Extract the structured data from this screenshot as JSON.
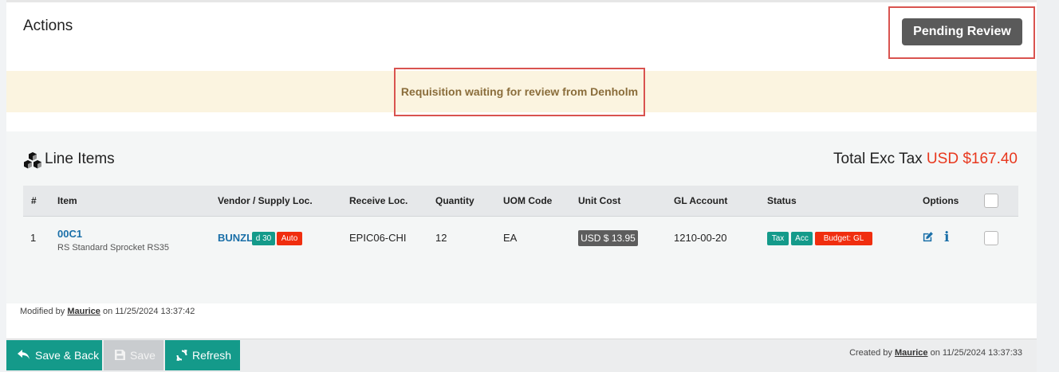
{
  "actions": {
    "title": "Actions",
    "pending_button": "Pending Review"
  },
  "notice": "Requisition waiting for review from Denholm",
  "line_items": {
    "title": "Line Items",
    "total_label": "Total Exc Tax",
    "total_amount": "USD $167.40",
    "columns": {
      "num": "#",
      "item": "Item",
      "vendor": "Vendor / Supply Loc.",
      "receive": "Receive Loc.",
      "quantity": "Quantity",
      "uom": "UOM Code",
      "unit_cost": "Unit Cost",
      "gl": "GL Account",
      "status": "Status",
      "options": "Options"
    },
    "rows": [
      {
        "num": "1",
        "item_code": "00C1",
        "item_desc": "RS Standard Sprocket RS35",
        "vendor": "BUNZL",
        "vendor_badges": [
          "d 30",
          "Auto"
        ],
        "receive": "EPIC06-CHI",
        "quantity": "12",
        "uom": "EA",
        "unit_cost": "USD $ 13.95",
        "gl": "1210-00-20",
        "status_badges": [
          "Tax",
          "Acc",
          "Budget: GL"
        ]
      }
    ]
  },
  "modified": {
    "prefix": "Modified by",
    "user": "Maurice",
    "suffix": "on 11/25/2024 13:37:42"
  },
  "footer": {
    "save_back": "Save & Back",
    "save": "Save",
    "refresh": "Refresh",
    "created_prefix": "Created by",
    "created_user": "Maurice",
    "created_suffix": "on 11/25/2024 13:37:33"
  },
  "colors": {
    "accent_teal": "#149a8a",
    "danger_red": "#f02e0f",
    "link_blue": "#1a6fa8",
    "highlight_red": "#d9534f",
    "notice_bg": "#fbf4e0",
    "notice_text": "#8a6d3b"
  },
  "icons": [
    "cubes-icon",
    "edit-icon",
    "info-icon",
    "reply-icon",
    "floppy-icon",
    "refresh-icon"
  ]
}
